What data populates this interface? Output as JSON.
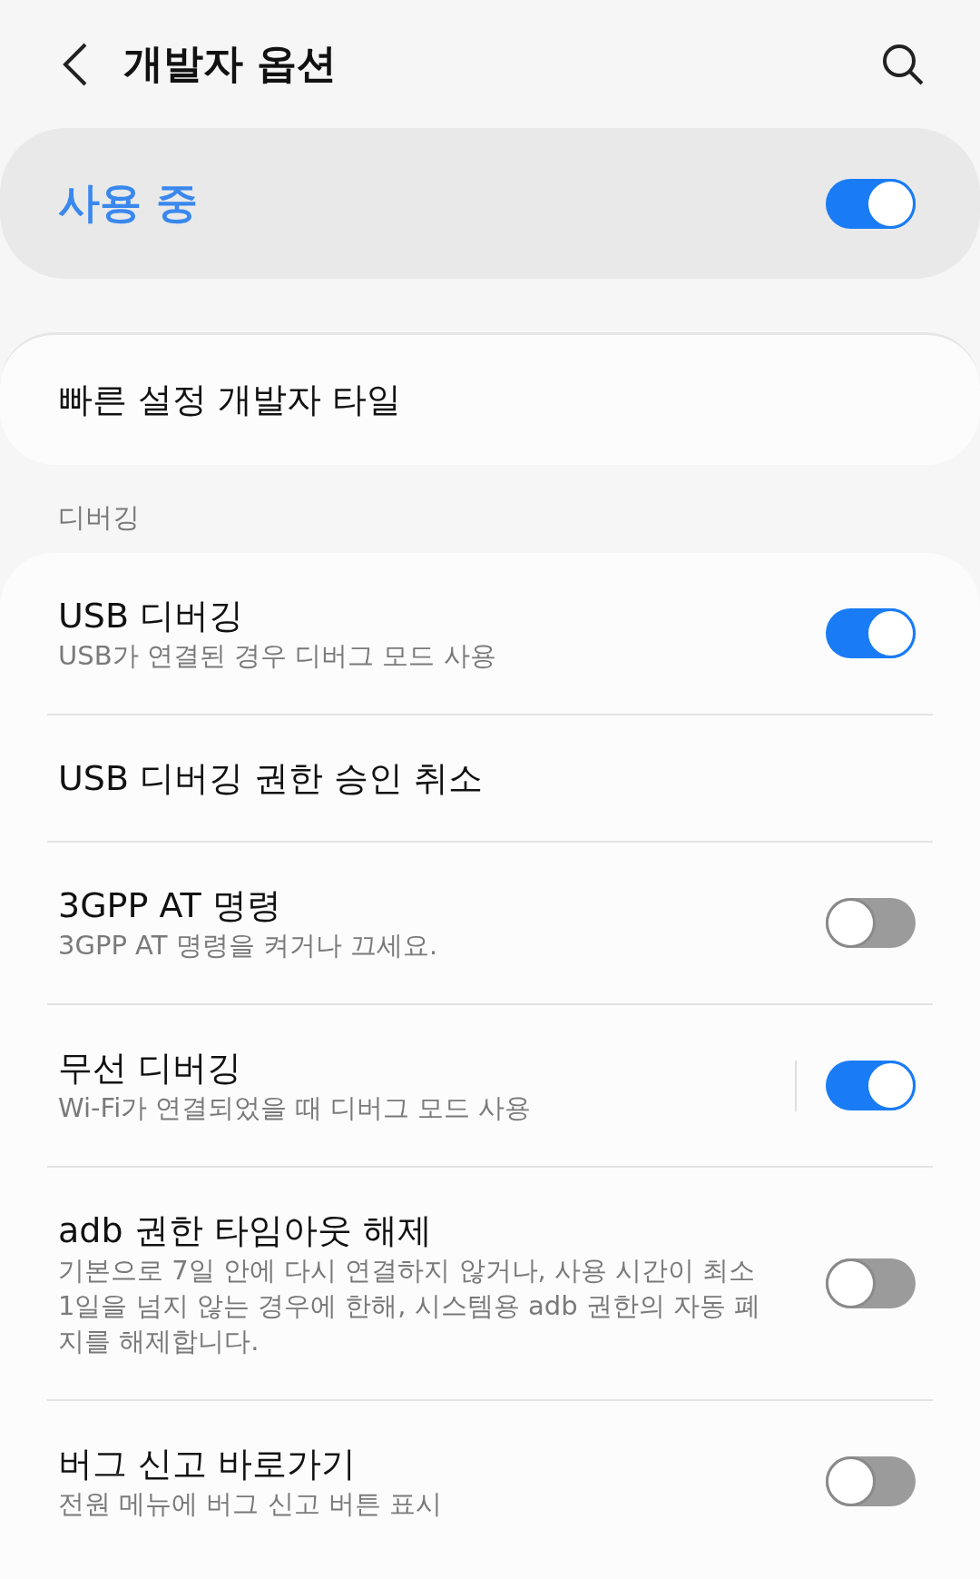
{
  "header": {
    "title": "개발자 옵션"
  },
  "master": {
    "label": "사용 중",
    "on": true
  },
  "quick_tile": {
    "label": "빠른 설정 개발자 타일"
  },
  "section": {
    "title": "디버깅",
    "items": [
      {
        "kind": "switch",
        "title": "USB 디버깅",
        "summary": "USB가 연결된 경우 디버그 모드 사용",
        "on": true
      },
      {
        "kind": "action",
        "title": "USB 디버깅 권한 승인 취소"
      },
      {
        "kind": "switch",
        "title": "3GPP AT 명령",
        "summary": "3GPP AT 명령을 켜거나 끄세요.",
        "on": false
      },
      {
        "kind": "split_switch",
        "title": "무선 디버깅",
        "summary": "Wi-Fi가 연결되었을 때 디버그 모드 사용",
        "on": true
      },
      {
        "kind": "switch",
        "title": "adb 권한 타임아웃 해제",
        "summary": "기본으로 7일 안에 다시 연결하지 않거나, 사용 시간이 최소 1일을 넘지 않는 경우에 한해, 시스템용 adb 권한의 자동 폐지를 해제합니다.",
        "on": false
      },
      {
        "kind": "switch",
        "title": "버그 신고 바로가기",
        "summary": "전원 메뉴에 버그 신고 버튼 표시",
        "on": false
      }
    ]
  }
}
